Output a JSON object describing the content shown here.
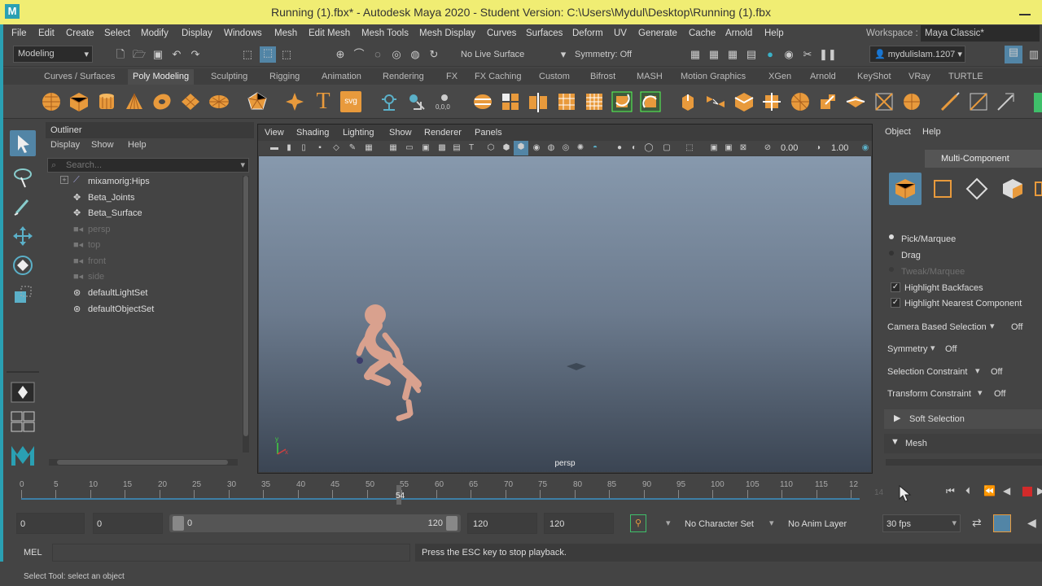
{
  "window": {
    "title": "Running (1).fbx* - Autodesk Maya 2020 - Student Version: C:\\Users\\Mydul\\Desktop\\Running (1).fbx",
    "logo": "M"
  },
  "menus": [
    "File",
    "Edit",
    "Create",
    "Select",
    "Modify",
    "Display",
    "Windows",
    "Mesh",
    "Edit Mesh",
    "Mesh Tools",
    "Mesh Display",
    "Curves",
    "Surfaces",
    "Deform",
    "UV",
    "Generate",
    "Cache",
    "Arnold",
    "Help"
  ],
  "workspace": {
    "label": "Workspace :",
    "value": "Maya Classic*"
  },
  "statusline": {
    "menuset": "Modeling",
    "live_surface": "No Live Surface",
    "symmetry": "Symmetry: Off",
    "user": "mydulislam.1207"
  },
  "shelf_tabs": [
    "Curves / Surfaces",
    "Poly Modeling",
    "Sculpting",
    "Rigging",
    "Animation",
    "Rendering",
    "FX",
    "FX Caching",
    "Custom",
    "Bifrost",
    "MASH",
    "Motion Graphics",
    "XGen",
    "Arnold",
    "KeyShot",
    "VRay",
    "TURTLE"
  ],
  "active_shelf_tab": "Poly Modeling",
  "shelf_text_icons": {
    "text": "T",
    "svg": "svg"
  },
  "outliner": {
    "title": "Outliner",
    "menu": [
      "Display",
      "Show",
      "Help"
    ],
    "search_placeholder": "Search...",
    "items": [
      {
        "label": "mixamorig:Hips",
        "dim": false,
        "icon": "joint-icon",
        "expand": "+"
      },
      {
        "label": "Beta_Joints",
        "dim": false,
        "icon": "transform-icon",
        "expand": ""
      },
      {
        "label": "Beta_Surface",
        "dim": false,
        "icon": "transform-icon",
        "expand": ""
      },
      {
        "label": "persp",
        "dim": true,
        "icon": "camera-icon",
        "expand": ""
      },
      {
        "label": "top",
        "dim": true,
        "icon": "camera-icon",
        "expand": ""
      },
      {
        "label": "front",
        "dim": true,
        "icon": "camera-icon",
        "expand": ""
      },
      {
        "label": "side",
        "dim": true,
        "icon": "camera-icon",
        "expand": ""
      },
      {
        "label": "defaultLightSet",
        "dim": false,
        "icon": "set-icon",
        "expand": ""
      },
      {
        "label": "defaultObjectSet",
        "dim": false,
        "icon": "set-icon",
        "expand": ""
      }
    ]
  },
  "viewport": {
    "menu": [
      "View",
      "Shading",
      "Lighting",
      "Show",
      "Renderer",
      "Panels"
    ],
    "near": "0.00",
    "far": "1.00",
    "camera_label": "persp",
    "axis": {
      "x": "x",
      "y": "y"
    }
  },
  "tool_settings": {
    "menu": [
      "Object",
      "Help"
    ],
    "mode": "Multi-Component",
    "options": [
      {
        "label": "Pick/Marquee",
        "dim": false
      },
      {
        "label": "Drag",
        "dim": false
      },
      {
        "label": "Tweak/Marquee",
        "dim": true
      }
    ],
    "checks": [
      "Highlight Backfaces",
      "Highlight Nearest Component"
    ],
    "dropdowns": [
      {
        "label": "Camera Based Selection",
        "value": "Off"
      },
      {
        "label": "Symmetry",
        "value": "Off"
      },
      {
        "label": "Selection Constraint",
        "value": "Off"
      },
      {
        "label": "Transform Constraint",
        "value": "Off"
      }
    ],
    "sections": [
      "Soft Selection",
      "Mesh"
    ]
  },
  "timeline": {
    "ticks": [
      "0",
      "5",
      "10",
      "15",
      "20",
      "25",
      "30",
      "35",
      "40",
      "45",
      "50",
      "55",
      "60",
      "65",
      "70",
      "75",
      "80",
      "85",
      "90",
      "95",
      "100",
      "105",
      "110",
      "115",
      "12"
    ],
    "current_frame": "54",
    "frame_field": "14"
  },
  "range": {
    "start": "0",
    "anim_start": "0",
    "slider_start": "0",
    "slider_end": "120",
    "anim_end": "120",
    "end": "120",
    "character_set": "No Character Set",
    "anim_layer": "No Anim Layer",
    "fps": "30 fps"
  },
  "command": {
    "label": "MEL",
    "result": "Press the ESC key to stop playback."
  },
  "help_line": "Select Tool: select an object",
  "colors": {
    "title_bar": "#f0ed73",
    "accent": "#5285a6",
    "shelf_icon": "#e89a3c",
    "viewport_top": "#8799ad",
    "viewport_bottom": "#3b4553",
    "figure": "#d9a18e",
    "record": "#d22a2a"
  }
}
